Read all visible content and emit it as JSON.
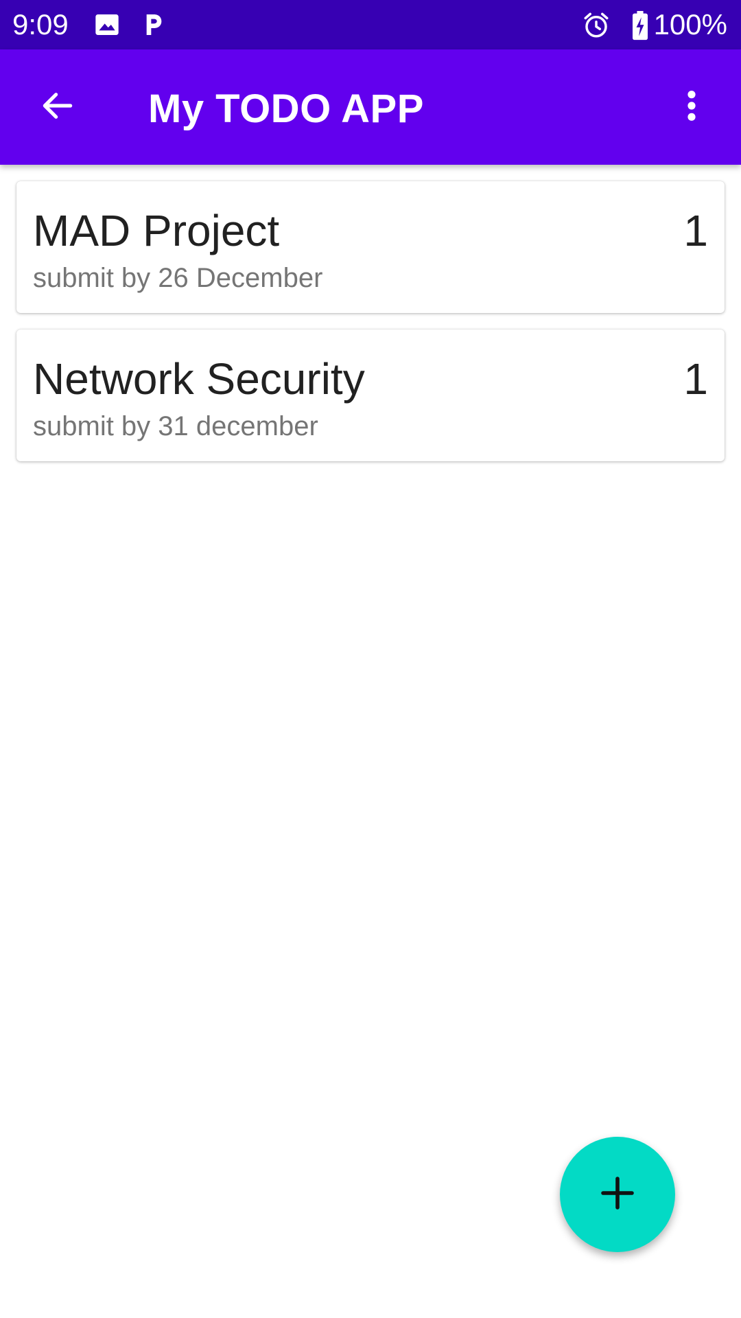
{
  "status_bar": {
    "time": "9:09",
    "battery_text": "100%",
    "icons": [
      "image-icon",
      "parking-icon",
      "alarm-icon",
      "battery-charging-icon"
    ]
  },
  "app_bar": {
    "title": "My TODO APP",
    "back_icon": "arrow-back-icon",
    "menu_icon": "more-vert-icon"
  },
  "todos": [
    {
      "title": "MAD Project",
      "subtitle": "submit by 26 December",
      "count": "1"
    },
    {
      "title": "Network Security",
      "subtitle": "submit by 31 december",
      "count": "1"
    }
  ],
  "fab": {
    "icon": "add-icon"
  },
  "colors": {
    "status_bar": "#3700b3",
    "app_bar": "#6200ee",
    "fab": "#03dac5"
  }
}
